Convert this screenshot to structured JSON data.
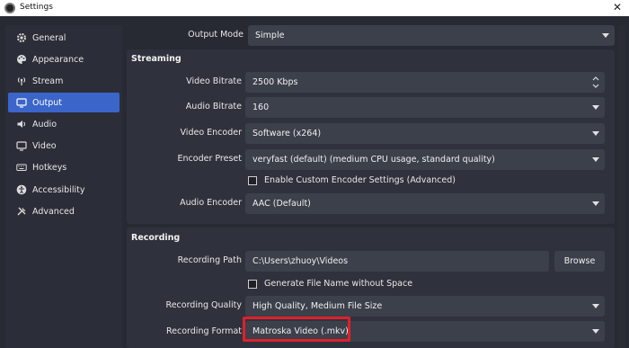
{
  "window": {
    "title": "Settings",
    "close_glyph": "✕"
  },
  "sidebar": {
    "items": [
      {
        "label": "General",
        "icon": "gear-icon"
      },
      {
        "label": "Appearance",
        "icon": "palette-icon"
      },
      {
        "label": "Stream",
        "icon": "broadcast-icon"
      },
      {
        "label": "Output",
        "icon": "monitor-output-icon",
        "active": true
      },
      {
        "label": "Audio",
        "icon": "speaker-icon"
      },
      {
        "label": "Video",
        "icon": "monitor-icon"
      },
      {
        "label": "Hotkeys",
        "icon": "keyboard-icon"
      },
      {
        "label": "Accessibility",
        "icon": "accessibility-icon"
      },
      {
        "label": "Advanced",
        "icon": "tools-icon"
      }
    ]
  },
  "output_mode": {
    "label": "Output Mode",
    "value": "Simple"
  },
  "streaming": {
    "title": "Streaming",
    "video_bitrate": {
      "label": "Video Bitrate",
      "value": "2500 Kbps"
    },
    "audio_bitrate": {
      "label": "Audio Bitrate",
      "value": "160"
    },
    "video_encoder": {
      "label": "Video Encoder",
      "value": "Software (x264)"
    },
    "encoder_preset": {
      "label": "Encoder Preset",
      "value": "veryfast (default) (medium CPU usage, standard quality)"
    },
    "custom_encoder": {
      "label": "Enable Custom Encoder Settings (Advanced)",
      "checked": false
    },
    "audio_encoder": {
      "label": "Audio Encoder",
      "value": "AAC (Default)"
    }
  },
  "recording": {
    "title": "Recording",
    "path": {
      "label": "Recording Path",
      "value": "C:\\Users\\zhuoy\\Videos"
    },
    "browse": "Browse",
    "no_space": {
      "label": "Generate File Name without Space",
      "checked": false
    },
    "quality": {
      "label": "Recording Quality",
      "value": "High Quality, Medium File Size"
    },
    "format": {
      "label": "Recording Format",
      "value": "Matroska Video (.mkv)"
    }
  },
  "colors": {
    "accent": "#3b65c9",
    "highlight": "#e0202a",
    "background": "#272a33"
  }
}
